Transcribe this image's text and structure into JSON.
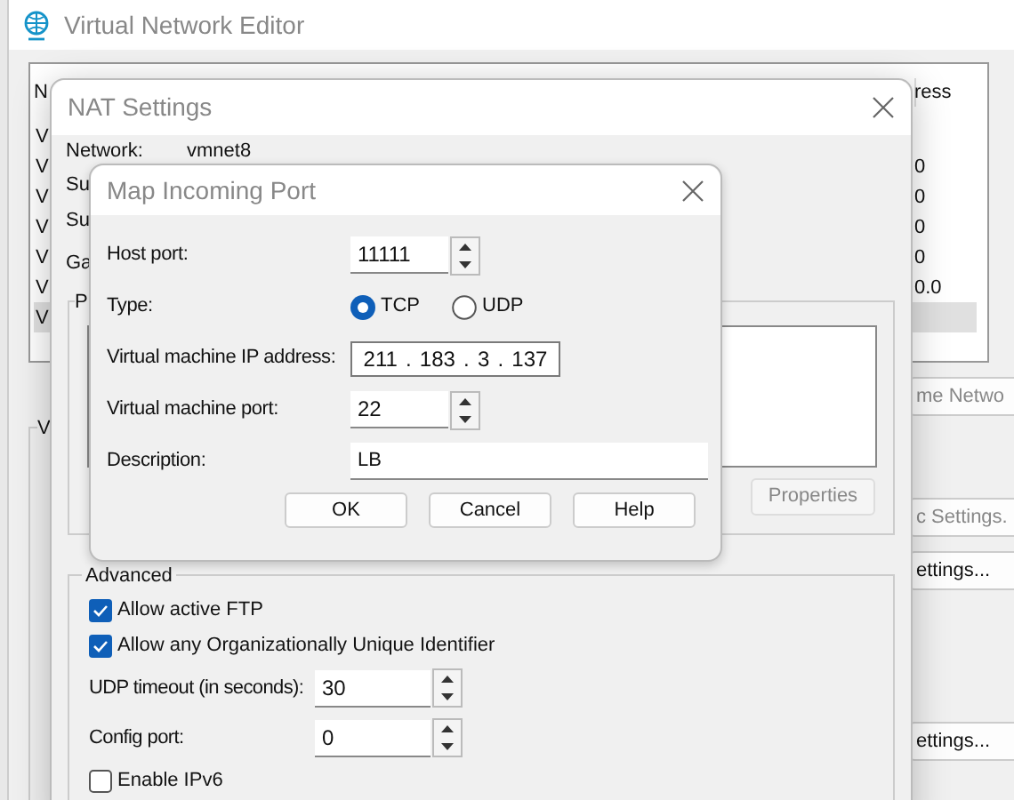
{
  "main_window": {
    "title": "Virtual Network Editor",
    "list": {
      "columns": [
        "N",
        "ress"
      ],
      "rows": [
        {
          "name": "V",
          "selected": false
        },
        {
          "name": "V",
          "address": "0",
          "selected": false
        },
        {
          "name": "V",
          "address": "0",
          "selected": false
        },
        {
          "name": "V",
          "address": "0",
          "selected": false
        },
        {
          "name": "V",
          "address": "0",
          "selected": false
        },
        {
          "name": "V",
          "address": "0.0",
          "selected": false
        },
        {
          "name": "V",
          "selected": true
        }
      ]
    },
    "group_label": "V",
    "side_buttons": [
      "me Netwo",
      "c Settings.",
      "ettings...",
      "ettings..."
    ]
  },
  "nat_settings": {
    "title": "NAT Settings",
    "network_label": "Network:",
    "network_value": "vmnet8",
    "labels": [
      "Su",
      "Su",
      "Ga"
    ],
    "port_group_label": "P",
    "properties_button": {
      "label": "Properties",
      "disabled": true
    },
    "advanced": {
      "label": "Advanced",
      "options": [
        {
          "kind": "checkbox",
          "label": "Allow active FTP",
          "checked": true
        },
        {
          "kind": "checkbox",
          "label": "Allow any Organizationally Unique Identifier",
          "checked": true
        },
        {
          "kind": "spin",
          "label": "UDP timeout (in seconds):",
          "value": "30"
        },
        {
          "kind": "spin",
          "label": "Config port:",
          "value": "0"
        },
        {
          "kind": "checkbox",
          "label": "Enable IPv6",
          "checked": false
        }
      ]
    }
  },
  "map_incoming_port": {
    "title": "Map Incoming Port",
    "fields": [
      {
        "kind": "spin",
        "label": "Host port:",
        "value": "11111"
      },
      {
        "kind": "radio",
        "label": "Type:",
        "options": [
          {
            "label": "TCP",
            "selected": true
          },
          {
            "label": "UDP",
            "selected": false
          }
        ]
      },
      {
        "kind": "ip",
        "label": "Virtual machine IP address:",
        "octets": [
          "211",
          "183",
          "3",
          "137"
        ],
        "separator": "."
      },
      {
        "kind": "spin",
        "label": "Virtual machine port:",
        "value": "22"
      },
      {
        "kind": "text",
        "label": "Description:",
        "value": "LB"
      }
    ],
    "buttons": [
      "OK",
      "Cancel",
      "Help"
    ]
  }
}
